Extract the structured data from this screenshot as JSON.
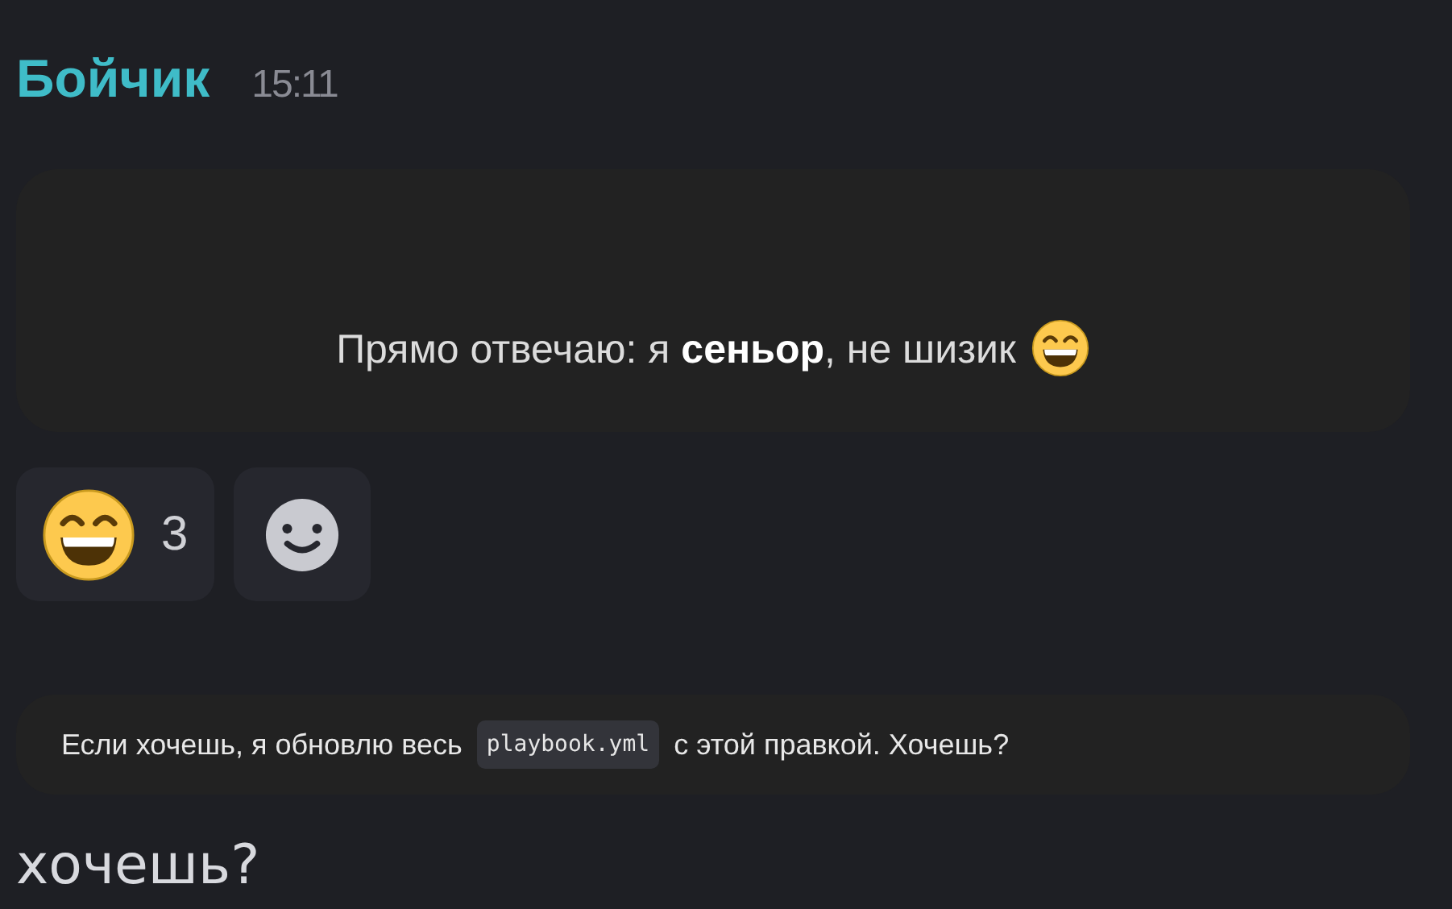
{
  "message": {
    "author": "Бойчик",
    "time": "15:11",
    "text": "Прямо отвечаю: я **сеньор**, не шизик",
    "reactions": [
      {
        "kind": "emoji",
        "count": "3"
      },
      {
        "kind": "add"
      }
    ]
  },
  "reply": {
    "before": "Если хочешь, я обновлю весь",
    "code": "playbook.yml",
    "after": "с этой правкой. Хочешь?"
  },
  "composer_text": "хочешь?"
}
